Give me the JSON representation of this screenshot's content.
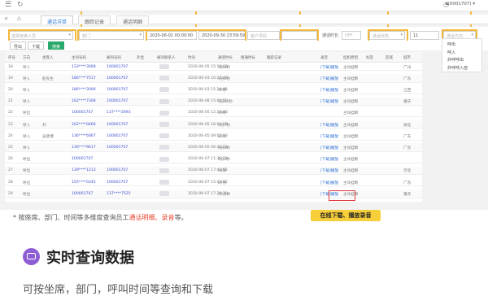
{
  "topbar": {
    "menu_icon": "hamburger-icon",
    "refresh_icon": "refresh-icon",
    "user": "(10001707) ▾",
    "bell_icon": "bell-icon"
  },
  "tabs": [
    {
      "label": "通话详单",
      "active": true
    },
    {
      "label": "跟踪记录",
      "active": false
    },
    {
      "label": "通话明细",
      "active": false
    }
  ],
  "filters": {
    "agent_placeholder": "选择坐席人员",
    "dept_placeholder": "部门",
    "start_time": "2020-06-01 00:00:00",
    "end_time": "2020-09-30 23:59:59",
    "phone_placeholder": "客户号码",
    "duration_label": "通话时长",
    "toggle_label": "OFF",
    "status_placeholder": "通话状态",
    "count_value": "11",
    "direction_placeholder": "通话方向"
  },
  "toolbar": {
    "export_label": "导出",
    "download_label": "下载",
    "search_label": "搜索"
  },
  "columns": [
    "序号",
    "方向",
    "坐席人",
    "主叫号码",
    "被叫号码",
    "外显",
    "被叫联系人",
    "时间",
    "通话时长",
    "接通时长",
    "跟踪记录",
    "录音",
    "挂机原因",
    "标签",
    "区域",
    "城市"
  ],
  "rows": [
    {
      "no": "18",
      "dir": "呼入",
      "agent": "",
      "caller": "133****3008",
      "callee": "100001707",
      "time": "2020-06-05 15:18:02",
      "dur": "3分4秒",
      "rec": "[下载]播放",
      "reason": "主叫挂断",
      "city": "广州"
    },
    {
      "no": "19",
      "dir": "呼入",
      "agent": "赵先生",
      "caller": "186****7517",
      "callee": "100001707",
      "time": "2020-06-03 10:27:47",
      "dur": "3分6秒",
      "rec": "[下载]播放",
      "reason": "主叫挂断",
      "city": "广东"
    },
    {
      "no": "20",
      "dir": "呼入",
      "agent": "",
      "caller": "186****3006",
      "callee": "100001707",
      "time": "2020-06-03 15:24:08",
      "dur": "56秒",
      "rec": "[下载]播放",
      "reason": "主叫挂断",
      "city": "江西"
    },
    {
      "no": "21",
      "dir": "呼入",
      "agent": "",
      "caller": "162****7308",
      "callee": "100001707",
      "time": "2020-06-08 15:04:50",
      "dur": "5分30秒",
      "rec": "[下载]播放",
      "reason": "主叫挂断",
      "city": "重庆"
    },
    {
      "no": "22",
      "dir": "呼出",
      "agent": "",
      "caller": "100001707",
      "callee": "137****2693",
      "time": "2020-06-05 12:24:43",
      "dur": "19秒",
      "rec": "",
      "reason": "主叫挂断",
      "city": ""
    },
    {
      "no": "23",
      "dir": "呼入",
      "agent": "刘",
      "caller": "162****0466",
      "callee": "100001707",
      "time": "2020-06-05 16:04:03",
      "dur": "2分7秒",
      "rec": "[下载]播放",
      "reason": "主叫挂断",
      "city": "湖北"
    },
    {
      "no": "24",
      "dir": "呼入",
      "agent": "吴晓博",
      "caller": "136****6067",
      "callee": "100001707",
      "time": "2020-06-05 09:02:13",
      "dur": "20秒",
      "rec": "[下载]播放",
      "reason": "主叫挂断",
      "city": "广东"
    },
    {
      "no": "25",
      "dir": "呼入",
      "agent": "",
      "caller": "136****9617",
      "callee": "100001707",
      "time": "2020-06-05 06:43:11",
      "dur": "3分3秒",
      "rec": "[下载]播放",
      "reason": "主叫挂断",
      "city": "广东"
    },
    {
      "no": "26",
      "dir": "呼出",
      "agent": "",
      "caller": "100001707",
      "callee": "",
      "time": "2020-06-07 11:36:21",
      "dur": "1分1秒",
      "rec": "[下载]播放",
      "reason": "主叫挂断",
      "city": ""
    },
    {
      "no": "27",
      "dir": "呼出",
      "agent": "",
      "caller": "139****1213",
      "callee": "100001707",
      "time": "2020-06-07 17:43:52",
      "dur": "14秒",
      "rec": "[下载]播放",
      "reason": "主叫挂断",
      "city": "河北"
    },
    {
      "no": "28",
      "dir": "呼出",
      "agent": "",
      "caller": "155****0345",
      "callee": "100001707",
      "time": "2020-06-07 15:43:52",
      "dur": "27秒",
      "rec": "[下载]播放",
      "reason": "主叫挂断",
      "city": "广东"
    },
    {
      "no": "29",
      "dir": "呼出",
      "agent": "",
      "caller": "100001707",
      "callee": "137****7525",
      "time": "2020-06-07 17:29:30",
      "dur": "15分钟",
      "rec": "[下载]播放",
      "reason": "主叫挂断",
      "city": "重庆"
    }
  ],
  "side_options": [
    "呼出",
    "呼入",
    "外呼呼出",
    "外呼呼入自"
  ],
  "callout_tag": "在线下载、播放录音",
  "note": {
    "prefix": "* 按座席、部门、时间等多维度查询员工",
    "highlight1": "通话明细",
    "sep": "、",
    "highlight2": "录音",
    "suffix": "等。"
  },
  "feature": {
    "icon": "chat-icon",
    "title": "实时查询数据",
    "desc": "可按坐席，部门，呼叫时间等查询和下载"
  }
}
